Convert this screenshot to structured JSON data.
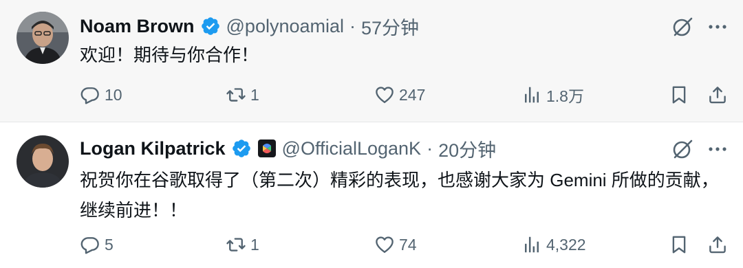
{
  "tweets": [
    {
      "name": "Noam Brown",
      "handle": "@polynoamial",
      "separator": "·",
      "time": "57分钟",
      "text": "欢迎！期待与你合作！",
      "replies": "10",
      "retweets": "1",
      "likes": "247",
      "views": "1.8万"
    },
    {
      "name": "Logan Kilpatrick",
      "handle": "@OfficialLoganK",
      "separator": "·",
      "time": "20分钟",
      "text": "祝贺你在谷歌取得了（第二次）精彩的表现，也感谢大家为 Gemini 所做的贡献，继续前进！！",
      "replies": "5",
      "retweets": "1",
      "likes": "74",
      "views": "4,322"
    }
  ],
  "icons": {
    "verified": "verified-badge-icon",
    "org_badge": "organization-badge-icon",
    "grok": "grok-icon",
    "more": "more-icon",
    "reply": "reply-icon",
    "retweet": "retweet-icon",
    "like": "heart-icon",
    "views": "views-icon",
    "bookmark": "bookmark-icon",
    "share": "share-icon"
  },
  "colors": {
    "verified": "#1d9bf0",
    "text": "#0f1419",
    "muted": "#536471",
    "tweet1_bg": "#f7f7f7"
  }
}
